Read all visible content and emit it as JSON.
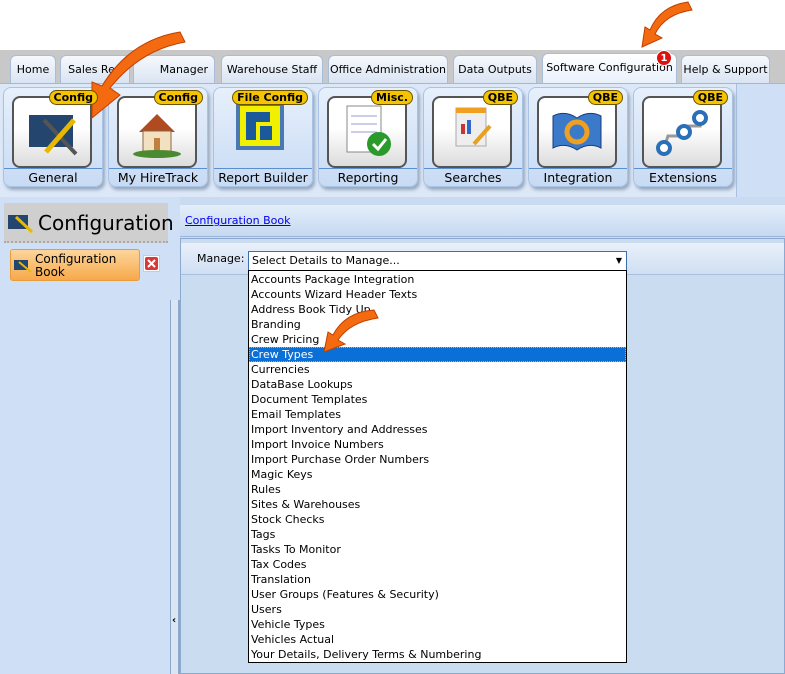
{
  "tabs": [
    {
      "label": "Home"
    },
    {
      "label": "Sales Rep"
    },
    {
      "label": "Manager"
    },
    {
      "label": "Warehouse Staff"
    },
    {
      "label": "Office Administration"
    },
    {
      "label": "Data Outputs"
    },
    {
      "label": "Software Configuration",
      "active": true,
      "badge": "1"
    },
    {
      "label": "Help & Support"
    }
  ],
  "ribbon": [
    {
      "label": "General",
      "badge": "Config",
      "icon": "config-tools-icon"
    },
    {
      "label": "My HireTrack",
      "badge": "Config",
      "icon": "house-icon"
    },
    {
      "label": "Report Builder",
      "badge": "File Config",
      "icon": "report-builder-icon"
    },
    {
      "label": "Reporting",
      "badge": "Misc.",
      "icon": "report-check-icon"
    },
    {
      "label": "Searches",
      "badge": "QBE",
      "icon": "search-report-icon"
    },
    {
      "label": "Integration",
      "badge": "QBE",
      "icon": "book-sync-icon"
    },
    {
      "label": "Extensions",
      "badge": "QBE",
      "icon": "extensions-icon"
    }
  ],
  "left": {
    "title": "Configuration",
    "item": "Configuration Book"
  },
  "main": {
    "breadcrumb": "Configuration Book",
    "manage_label": "Manage:",
    "combo_value": "Select Details to Manage...",
    "options": [
      "Accounts Package Integration",
      "Accounts Wizard Header Texts",
      "Address Book Tidy Up",
      "Branding",
      "Crew Pricing",
      "Crew Types",
      "Currencies",
      "DataBase Lookups",
      "Document Templates",
      "Email Templates",
      "Import Inventory and Addresses",
      "Import Invoice Numbers",
      "Import Purchase Order Numbers",
      "Magic Keys",
      "Rules",
      "Sites & Warehouses",
      "Stock Checks",
      "Tags",
      "Tasks To Monitor",
      "Tax Codes",
      "Translation",
      "User Groups (Features & Security)",
      "Users",
      "Vehicle Types",
      "Vehicles Actual",
      "Your Details, Delivery Terms & Numbering"
    ],
    "selected": "Crew Types"
  },
  "colors": {
    "accent": "#f7a94a",
    "selection": "#0a6fd6",
    "ribbon": "#dce8f8",
    "badge": "#f5c400"
  }
}
